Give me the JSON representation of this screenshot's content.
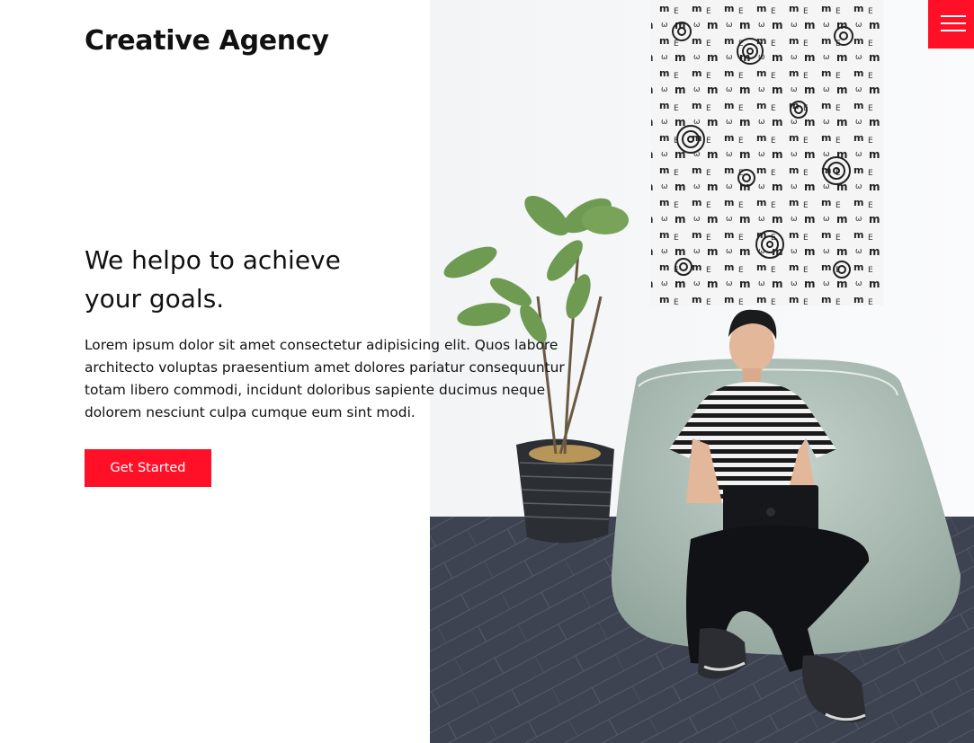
{
  "header": {
    "brand": "Creative Agency",
    "menu_icon": "hamburger-menu-icon"
  },
  "hero": {
    "headline_line1": "We helpo to achieve",
    "headline_line2": "your goals.",
    "description": "Lorem ipsum dolor sit amet consectetur adipisicing elit. Quos labore architecto voluptas praesentium amet dolores pariatur consequuntur totam libero commodi, incidunt doloribus sapiente ducimus neque dolorem nesciunt culpa cumque eum sint modi.",
    "cta_label": "Get Started"
  },
  "colors": {
    "accent": "#ff1027",
    "text": "#111111",
    "background": "#ffffff"
  }
}
